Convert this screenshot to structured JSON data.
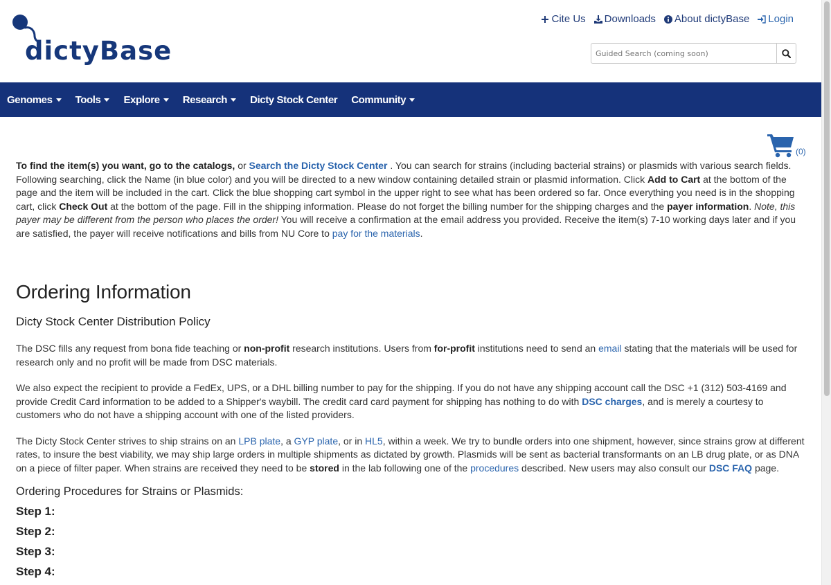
{
  "logo": {
    "text": "dictyBase"
  },
  "top_links": [
    {
      "label": "Cite Us",
      "icon": "plus-icon"
    },
    {
      "label": "Downloads",
      "icon": "download-icon"
    },
    {
      "label": "About dictyBase",
      "icon": "info-circle-icon"
    },
    {
      "label": "Login",
      "icon": "sign-in-icon"
    }
  ],
  "search": {
    "placeholder": "Guided Search (coming soon)"
  },
  "nav": [
    {
      "label": "Genomes"
    },
    {
      "label": "Tools"
    },
    {
      "label": "Explore"
    },
    {
      "label": "Research"
    },
    {
      "label": "Dicty Stock Center"
    },
    {
      "label": "Community"
    }
  ],
  "cart": {
    "count": "(0)"
  },
  "intro": {
    "bold_lead": "To find the item(s) you want, go to the catalogs,",
    "t1": " or ",
    "link_search": "Search the Dicty Stock Center",
    "t2": " . You can search for strains (including bacterial strains) or plasmids with various search fields. Following searching, click the Name (in blue color) and you will be directed to a new window containing detailed strain or plasmid information. Click ",
    "bold_add": "Add to Cart",
    "t3": " at the bottom of the page and the item will be included in the cart. Click the blue shopping cart symbol in the upper right to see what has been ordered so far. Once everything you need is in the shopping cart, click ",
    "bold_checkout": "Check Out",
    "t4": " at the bottom of the page. Fill in the shipping information. Please do not forget the billing number for the shipping charges and the ",
    "bold_payer": "payer information",
    "t5": ". ",
    "italic_note": "Note, this payer may be different from the person who places the order!",
    "t6": " You will receive a confirmation at the email address you provided. Receive the item(s) 7-10 working days later and if you are satisfied, the payer will receive notifications and bills from NU Core to ",
    "link_pay": "pay for the materials",
    "t7": "."
  },
  "heading": "Ordering Information",
  "subheading": "Dicty Stock Center Distribution Policy",
  "policy": {
    "t1": "The DSC fills any request from bona fide teaching or ",
    "bold_nonprofit": "non-profit",
    "t2": " research institutions. Users from ",
    "bold_forprofit": "for-profit",
    "t3": " institutions need to send an ",
    "link_email": "email",
    "t4": " stating that the materials will be used for research only and no profit will be made from DSC materials."
  },
  "shipping": {
    "t1": "We also expect the recipient to provide a FedEx, UPS, or a DHL billing number to pay for the shipping. If you do not have any shipping account call the DSC +1 (312) 503-4169 and provide Credit Card information to be added to a Shipper's waybill. The credit card card payment for shipping has nothing to do with ",
    "link_charges": "DSC charges",
    "t2": ", and is merely a courtesy to customers who do not have a shipping account with one of the listed providers."
  },
  "strains": {
    "t1": "The Dicty Stock Center strives to ship strains on an ",
    "link_lpb": "LPB plate",
    "t2": ", a ",
    "link_gyp": "GYP plate",
    "t3": ", or in ",
    "link_hl5": "HL5",
    "t4": ", within a week. We try to bundle orders into one shipment, however, since strains grow at different rates, to insure the best viability, we may ship large orders in multiple shipments as dictated by growth. Plasmids will be sent as bacterial transformants on an LB drug plate, or as DNA on a piece of filter paper. When strains are received they need to be ",
    "bold_stored": "stored",
    "t5": " in the lab following one of the ",
    "link_procedures": "procedures",
    "t6": " described. New users may also consult our ",
    "link_faq": "DSC FAQ",
    "t7": " page."
  },
  "procedures_heading": "Ordering Procedures for Strains or Plasmids:",
  "steps": [
    "Step 1:",
    "Step 2:",
    "Step 3:",
    "Step 4:"
  ]
}
